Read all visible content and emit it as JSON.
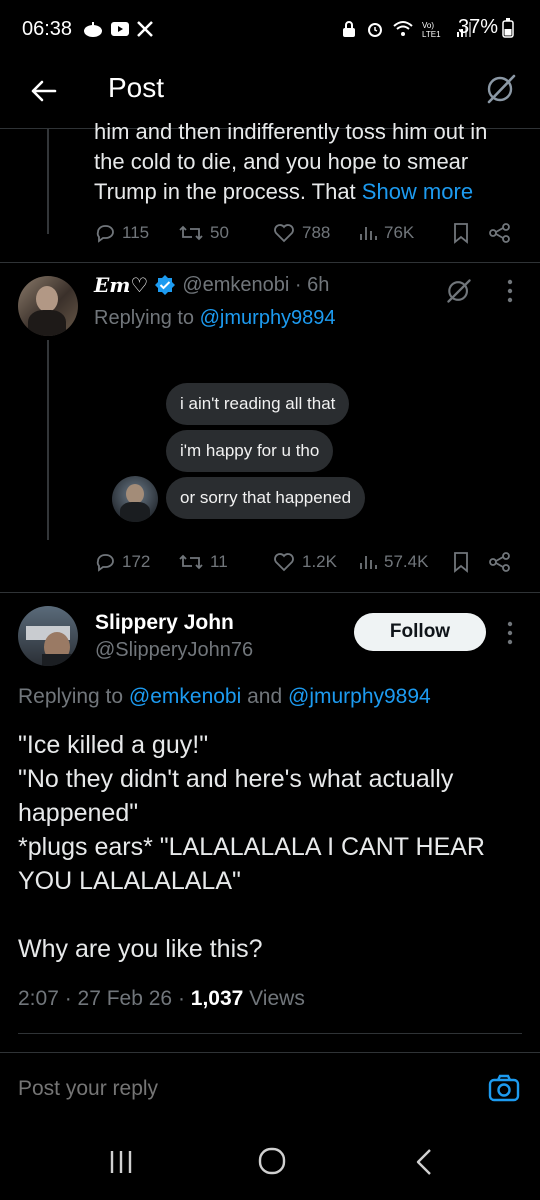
{
  "status_bar": {
    "time": "06:38",
    "battery": "37%"
  },
  "header": {
    "title": "Post"
  },
  "prev_tweet": {
    "text_line1": "him and then indifferently toss him out in",
    "text_line2": "the cold to die, and you hope to smear",
    "text_line3": "Trump in the process. That ",
    "show_more": "Show more",
    "replies": "115",
    "reposts": "50",
    "likes": "788",
    "views": "76K"
  },
  "em_tweet": {
    "name": "Em♡",
    "handle": "@emkenobi · 6h",
    "replying_prefix": "Replying to ",
    "replying_to": "@jmurphy9894",
    "bubbles": [
      "i ain't reading all that",
      "i'm happy for u tho",
      "or sorry that happened"
    ],
    "replies": "172",
    "reposts": "11",
    "likes": "1.2K",
    "views": "57.4K"
  },
  "main_tweet": {
    "name": "Slippery John",
    "handle": "@SlipperyJohn76",
    "follow_label": "Follow",
    "replying_prefix": "Replying to ",
    "replying_to_1": "@emkenobi",
    "replying_and": " and ",
    "replying_to_2": "@jmurphy9894",
    "line1": "\"Ice killed a guy!\"",
    "line2": "\"No they didn't and here's what actually",
    "line3": "happened\"",
    "line4": "*plugs ears*  \"LALALALALA I CANT HEAR",
    "line5": "YOU LALALALALA\"",
    "line6": "Why are you like this?",
    "time": "2:07 · 27 Feb 26 · ",
    "views_count": "1,037",
    "views_label": " Views"
  },
  "reply_bar": {
    "placeholder": "Post your reply"
  },
  "colors": {
    "accent": "#1d9bf0",
    "background": "#000000",
    "muted": "#71767b"
  }
}
